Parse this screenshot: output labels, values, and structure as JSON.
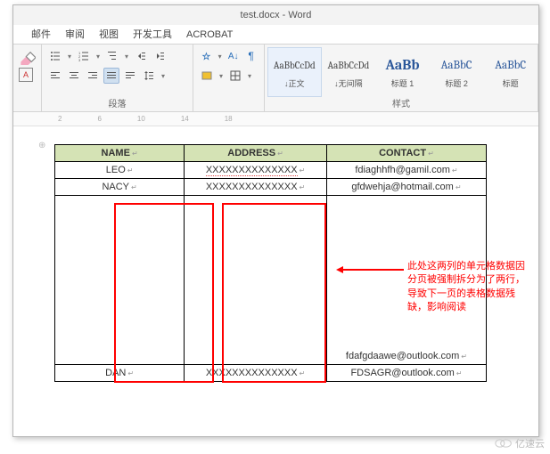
{
  "title": "test.docx - Word",
  "tabs": [
    "邮件",
    "审阅",
    "视图",
    "开发工具",
    "ACROBAT"
  ],
  "groups": {
    "para": "段落",
    "styles": "样式"
  },
  "styles": [
    {
      "preview": "AaBbCcDd",
      "name": "↓正文",
      "sel": true,
      "cls": ""
    },
    {
      "preview": "AaBbCcDd",
      "name": "↓无间隔",
      "sel": false,
      "cls": ""
    },
    {
      "preview": "AaBb",
      "name": "标题 1",
      "sel": false,
      "cls": "h"
    },
    {
      "preview": "AaBbC",
      "name": "标题 2",
      "sel": false,
      "cls": "h2"
    },
    {
      "preview": "AaBbC",
      "name": "标题",
      "sel": false,
      "cls": "h2"
    }
  ],
  "table": {
    "headers": [
      "NAME",
      "ADDRESS",
      "CONTACT"
    ],
    "rows": [
      [
        "LEO",
        "XXXXXXXXXXXXXX",
        "fdiaghhfh@gamil.com"
      ],
      [
        "NACY",
        "XXXXXXXXXXXXXX",
        "gfdwehja@hotmail.com"
      ],
      [
        "",
        "",
        "fdafgdaawe@outlook.com"
      ],
      [
        "DAN",
        "XXXXXXXXXXXXXX",
        "FDSAGR@outlook.com"
      ]
    ]
  },
  "annotation": "此处这两列的单元格数据因分页被强制拆分为了两行，导致下一页的表格数据残缺，影响阅读",
  "icons": {
    "boxA": "A"
  },
  "watermark": "亿速云"
}
